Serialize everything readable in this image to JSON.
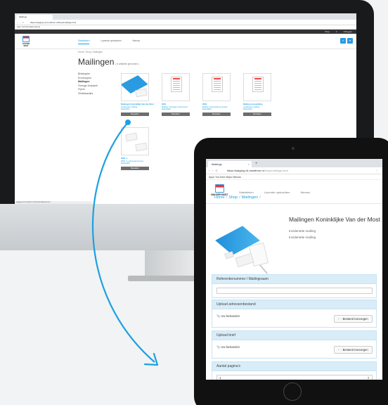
{
  "colors": {
    "accent": "#1aa3df",
    "arrow": "#1ea0e0",
    "panel_header": "#d8edf8",
    "brand_red": "#e7334d"
  },
  "monitor": {
    "tab_title": "Mailings",
    "url": "https://staging.vd-mostfrom.nl/shop/mailings.html",
    "bookmarks": "Apps  YouTube  Maps  Nieuws",
    "topbar": {
      "item1": "Shop",
      "item2": "2",
      "item3": "Uitloggen"
    },
    "menu": [
      "Statistieken",
      "Lopende opdrachten",
      "Nieuws"
    ],
    "breadcrumb": "Home / Shop / Mailingen",
    "title": "Mailingen",
    "title_count": "( 6 artikelen gevonden )",
    "sidebar": [
      "Briefpapier",
      "Enveloppen",
      "Mailingen",
      "Overige drukwerk",
      "Flyers",
      "Visitekaartjes"
    ],
    "products": [
      {
        "title": "Mailingen Koninklijke Van der Most",
        "subtitle": "Incidentele mailing",
        "code": "MAIL0001",
        "button": "Bestellen"
      },
      {
        "title": "0001",
        "subtitle": "Mailing \"Opvolgen referenties\"",
        "code": "MAIL0002",
        "button": "Bestellen"
      },
      {
        "title": "0002",
        "subtitle": "Mailing \"Aanmelding nieuwe\"",
        "code": "MAIL0003",
        "button": "Bestellen"
      },
      {
        "title": "Mailing na bestelling",
        "subtitle": "Incidentele mailing",
        "code": "MAIL0004",
        "button": "Bestellen"
      },
      {
        "title": "0003 -1",
        "subtitle": "0003 -1 referentieverzoek",
        "code": "MAIL0005",
        "button": "Bestellen"
      }
    ],
    "status": "staging.vd-mostfrom.nl/shop/mailings.html"
  },
  "tablet": {
    "tab_title": "Mailings",
    "tab_close": "×",
    "new_tab": "+",
    "nav": "‹ › C",
    "url_host": "https://staging.vd-mostfrom.nl",
    "url_path": "/shop/mailings.html",
    "url_dots": "⋮",
    "bookmarks": "Apps  YouTube  Maps  Nieuws",
    "logo": "VAN DER MOST",
    "menu": [
      "Statistieken",
      "Lopende opdrachten",
      "Nieuws"
    ],
    "breadcrumb": {
      "home": "Home",
      "shop": "Shop",
      "current": "Mailingen",
      "sep": "/"
    },
    "product_title": "Mailingen Koninklijke Van der Most",
    "subtitle1": "Incidentele mailing",
    "subtitle2": "Incidentele mailing",
    "panels": {
      "reference_label": "Referentienummer / Mailingnaam",
      "reference_value": "",
      "upload_addresses_label": "Upload adressenbestand",
      "your_files_1": "Uw bestanden",
      "add_file_1": "Bestand toevoegen",
      "upload_letter_label": "Upload brief",
      "your_files_2": "Uw bestanden",
      "add_file_2": "Bestand toevoegen",
      "pages_label": "Aantal pagina's",
      "pages_value": "1"
    }
  }
}
